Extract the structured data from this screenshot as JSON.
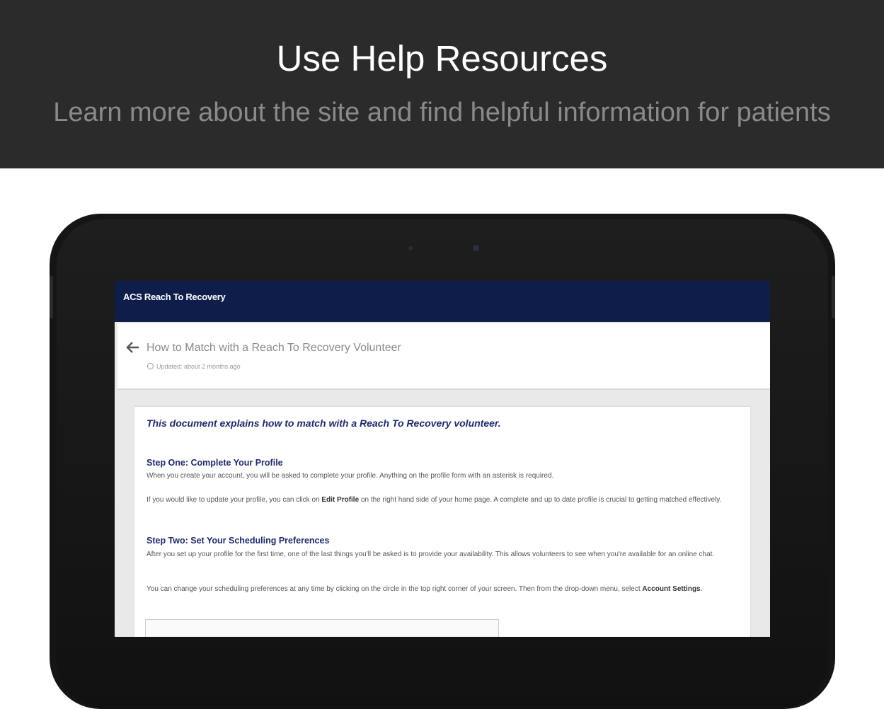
{
  "banner": {
    "title": "Use Help Resources",
    "subtitle": "Learn more about the site and find helpful information for patients"
  },
  "app": {
    "title": "ACS Reach To Recovery"
  },
  "article": {
    "title": "How to Match with a Reach To Recovery Volunteer",
    "updated": "Updated: about 2 months ago",
    "intro": "This document explains how to match with a Reach To Recovery volunteer.",
    "step1": {
      "heading": "Step One: Complete Your Profile",
      "p1": "When you create your account, you will be asked to complete your profile. Anything on the profile form with an asterisk is required.",
      "p2_before": "If you would like to update your profile, you can click on ",
      "p2_bold": "Edit Profile",
      "p2_after": " on the right hand side of your home page. A complete and up to date profile is crucial to getting matched effectively."
    },
    "step2": {
      "heading": "Step Two: Set Your Scheduling Preferences",
      "p1": "After you set up your profile for the first time, one of the last things you'll be asked is to provide your availability. This allows volunteers to see when you're available for an online chat.",
      "p2_before": "You can change your scheduling preferences at any time by clicking on the circle in the top right corner of your screen. Then from the drop-down menu, select ",
      "p2_bold": "Account Settings",
      "p2_after": "."
    }
  },
  "colors": {
    "banner_bg": "#2b2b2b",
    "appbar_bg": "#0e1d4a",
    "heading_blue": "#1f2a6b"
  }
}
